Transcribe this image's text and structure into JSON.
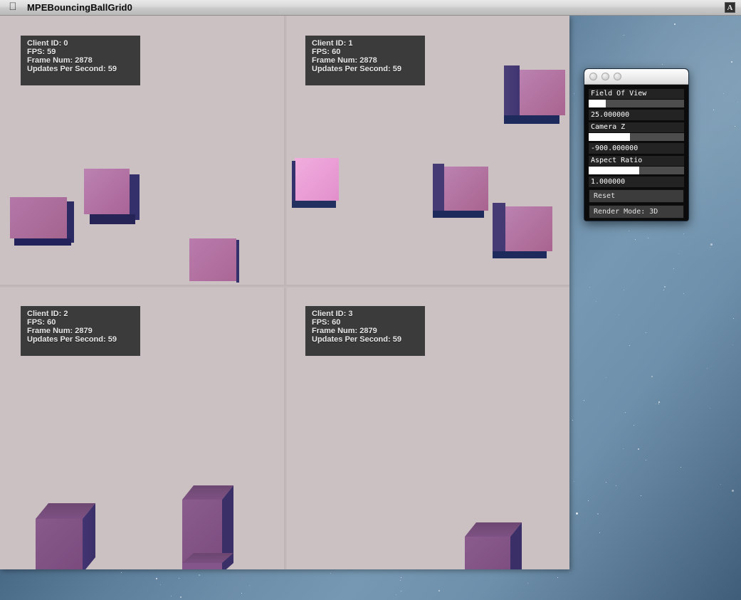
{
  "menubar": {
    "apple_icon": "apple-logo",
    "app_title": "MPEBouncingBallGrid0",
    "extra_icon_label": "A"
  },
  "app": {
    "background_color": "#cbc1c2",
    "quadrants": [
      {
        "client_id_label": "Client ID: 0",
        "fps_label": "FPS: 59",
        "frame_num_label": "Frame Num: 2878",
        "ups_label": "Updates Per Second: 59"
      },
      {
        "client_id_label": "Client ID: 1",
        "fps_label": "FPS: 60",
        "frame_num_label": "Frame Num: 2878",
        "ups_label": "Updates Per Second: 59"
      },
      {
        "client_id_label": "Client ID: 2",
        "fps_label": "FPS: 60",
        "frame_num_label": "Frame Num: 2879",
        "ups_label": "Updates Per Second: 59"
      },
      {
        "client_id_label": "Client ID: 3",
        "fps_label": "FPS: 60",
        "frame_num_label": "Frame Num: 2879",
        "ups_label": "Updates Per Second: 59"
      }
    ]
  },
  "control_panel": {
    "window_buttons": [
      "close-button",
      "minimize-button",
      "zoom-button"
    ],
    "field_of_view": {
      "label": "Field Of View",
      "value": "25.000000",
      "fill_percent": 18
    },
    "camera_z": {
      "label": "Camera Z",
      "value": "-900.000000",
      "fill_percent": 43
    },
    "aspect_ratio": {
      "label": "Aspect Ratio",
      "value": "1.000000",
      "fill_percent": 53
    },
    "reset_label": "Reset",
    "render_mode_label": "Render Mode: 3D"
  },
  "colors": {
    "canvas_bg": "#cbc1c2",
    "cube_front_pink": "#b06ba0",
    "cube_front_light_pink": "#ec9fd8",
    "cube_front_purple": "#7e4c81",
    "cube_dark_navy": "#2a2a62",
    "cube_dark_indigo": "#413066",
    "info_box_bg": "#3b3b3b",
    "info_text": "#e7e7e7",
    "panel_bg": "#0b0b0b"
  }
}
